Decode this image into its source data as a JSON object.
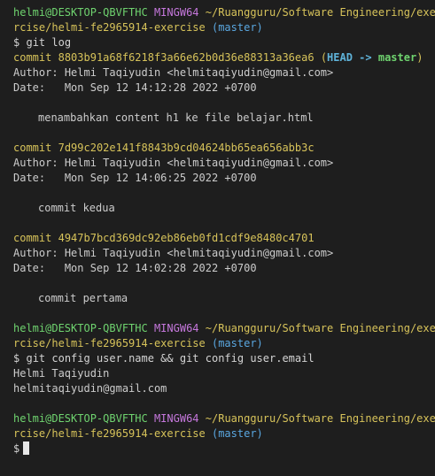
{
  "prompt": {
    "user_host": "helmi@DESKTOP-QBVFTHC",
    "shell": "MINGW64",
    "path_line1": "~/Ruangguru/Software Engineering/exe",
    "path_line2": "rcise/helmi-fe2965914-exercise",
    "branch": "(master)",
    "symbol": "$"
  },
  "commands": {
    "git_log": "git log",
    "git_config": "git config user.name && git config user.email"
  },
  "commits": [
    {
      "label": "commit",
      "hash": "8803b91a68f6218f3a66e62b0d36e88313a36ea6",
      "ref_open": "(",
      "ref_head": "HEAD",
      "ref_arrow": " -> ",
      "ref_branch": "master",
      "ref_close": ")",
      "author_label": "Author:",
      "author": "Helmi Taqiyudin <helmitaqiyudin@gmail.com>",
      "date_label": "Date:",
      "date": "Mon Sep 12 14:12:28 2022 +0700",
      "message": "menambahkan content h1 ke file belajar.html"
    },
    {
      "label": "commit",
      "hash": "7d99c202e141f8843b9cd04624bb65ea656abb3c",
      "author_label": "Author:",
      "author": "Helmi Taqiyudin <helmitaqiyudin@gmail.com>",
      "date_label": "Date:",
      "date": "Mon Sep 12 14:06:25 2022 +0700",
      "message": "commit kedua"
    },
    {
      "label": "commit",
      "hash": "4947b7bcd369dc92eb86eb0fd1cdf9e8480c4701",
      "author_label": "Author:",
      "author": "Helmi Taqiyudin <helmitaqiyudin@gmail.com>",
      "date_label": "Date:",
      "date": "Mon Sep 12 14:02:28 2022 +0700",
      "message": "commit pertama"
    }
  ],
  "config_output": {
    "user_name": "Helmi Taqiyudin",
    "user_email": "helmitaqiyudin@gmail.com"
  },
  "colors": {
    "background": "#1e1e1e",
    "user_host": "#6fd36f",
    "shell": "#c678dd",
    "path": "#d7c35a",
    "branch": "#5aa7e0",
    "commit_hash": "#d7c35a",
    "text": "#cccccc"
  },
  "icons": {
    "cursor": "block-cursor"
  }
}
